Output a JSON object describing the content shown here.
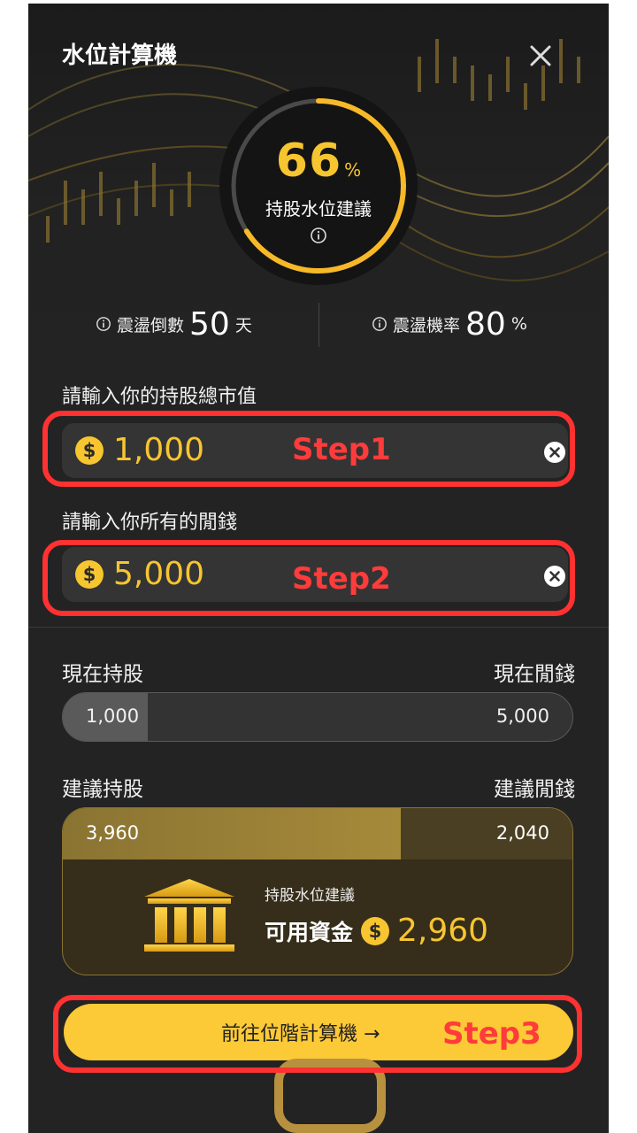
{
  "app": {
    "title": "水位計算機"
  },
  "gauge": {
    "value": "66",
    "unit": "%",
    "label": "持股水位建議",
    "progress": 0.66
  },
  "stats": {
    "countdown": {
      "label": "震盪倒數",
      "value": "50",
      "unit": "天"
    },
    "probability": {
      "label": "震盪機率",
      "value": "80",
      "unit": "%"
    }
  },
  "inputs": {
    "holdings": {
      "label": "請輸入你的持股總市值",
      "value": "1,000"
    },
    "cash": {
      "label": "請輸入你所有的閒錢",
      "value": "5,000"
    }
  },
  "current": {
    "holdings_label": "現在持股",
    "cash_label": "現在閒錢",
    "holdings": "1,000",
    "cash": "5,000"
  },
  "suggested": {
    "holdings_label": "建議持股",
    "cash_label": "建議閒錢",
    "holdings": "3,960",
    "cash": "2,040"
  },
  "card": {
    "subtitle": "持股水位建議",
    "available_label": "可用資金",
    "available_value": "2,960"
  },
  "cta": {
    "label": "前往位階計算機 →"
  },
  "annotations": {
    "step1": "Step1",
    "step2": "Step2",
    "step3": "Step3"
  },
  "colors": {
    "accent": "#f7c530",
    "annotation": "#ff3131",
    "background": "#232323",
    "cta": "#fcc937"
  },
  "icons": {
    "close": "close-icon",
    "info": "info-icon",
    "coin": "dollar-coin-icon",
    "clear": "clear-icon",
    "bank": "bank-icon"
  }
}
